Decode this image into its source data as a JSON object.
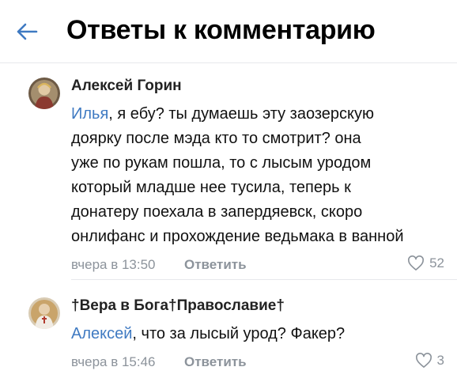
{
  "header": {
    "title": "Ответы к комментарию",
    "back_icon": "arrow-left-icon",
    "accent_color": "#3f7ac2"
  },
  "comments": [
    {
      "author": "Алексей Горин",
      "mention": "Илья",
      "lines": [
        ", я ебу? ты думаешь эту заозерскую",
        "доярку после мэда кто то смотрит? она",
        "уже по рукам пошла, то с лысым уродом",
        "который младше нее тусила, теперь к",
        "донатеру поехала в запердяевск, скоро",
        "онлифанс и прохождение ведьмака в ванной"
      ],
      "time": "вчера в 13:50",
      "reply_label": "Ответить",
      "likes": "52"
    },
    {
      "author": "†Вера в Бога†Православие†",
      "mention": "Алексей",
      "lines": [
        ", что за лысый урод? Факер?"
      ],
      "time": "вчера в 15:46",
      "reply_label": "Ответить",
      "likes": "3"
    }
  ]
}
